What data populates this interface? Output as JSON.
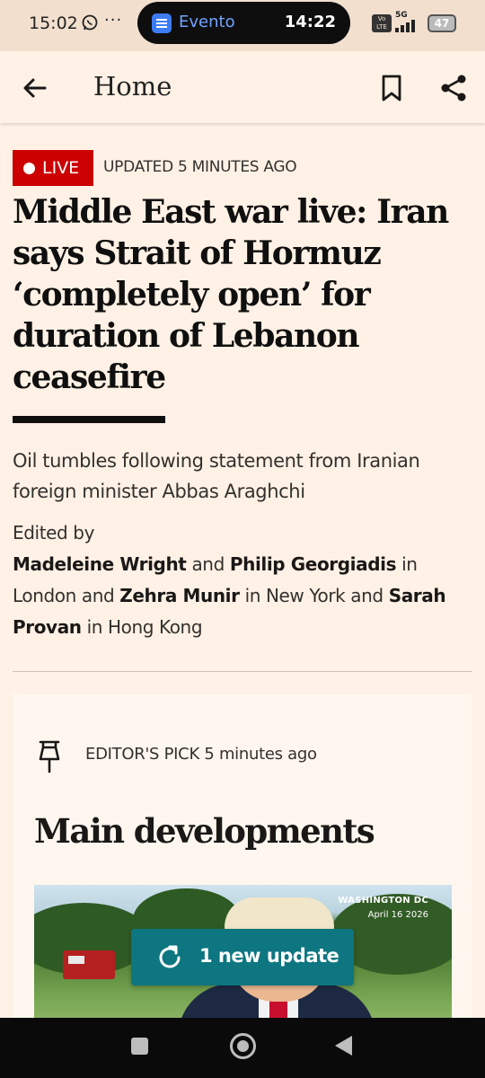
{
  "status_bar": {
    "time": "15:02",
    "app_name": "Evento",
    "pill_time": "14:22",
    "network": "5G",
    "volte": "Vo LTE",
    "battery": "47"
  },
  "app_bar": {
    "title": "Home",
    "icons": [
      "arrow-back-icon",
      "bookmark-icon",
      "share-icon"
    ]
  },
  "article": {
    "live_label": "LIVE",
    "updated": "UPDATED 5 MINUTES AGO",
    "headline": "Middle East war live: Iran says Strait of Hormuz ‘completely open’ for duration of Lebanon ceasefire",
    "standfirst": "Oil tumbles following statement from Iranian foreign minister Abbas Araghchi",
    "edited_by_label": "Edited by",
    "editors": {
      "e1": "Madeleine Wright",
      "and1": "and",
      "e2": "Philip Georgiadis",
      "loc1": "in London and",
      "e3": "Zehra Munir",
      "loc2": "in New York and",
      "e4": "Sarah Provan",
      "loc3": "in Hong Kong"
    }
  },
  "editors_pick": {
    "label": "EDITOR'S PICK 5 minutes ago",
    "title": "Main developments",
    "photo_location": "WASHINGTON DC",
    "photo_date": "April 16 2026"
  },
  "update_button": {
    "label": "1 new update"
  },
  "colors": {
    "background": "#FFF1E5",
    "live_red": "#CC0000",
    "teal": "#0D7680"
  }
}
